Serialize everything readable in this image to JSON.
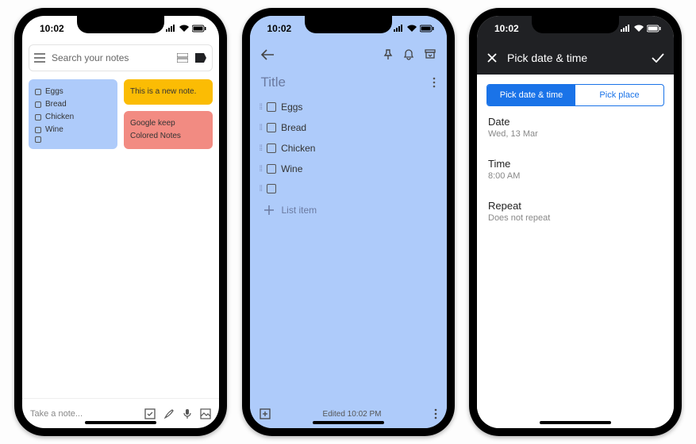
{
  "status": {
    "time": "10:02"
  },
  "phone1": {
    "search_placeholder": "Search your notes",
    "notes": {
      "checklist": [
        "Eggs",
        "Bread",
        "Chicken",
        "Wine"
      ],
      "yellow": "This is a new note.",
      "red_line1": "Google keep",
      "red_line2": "Colored Notes"
    },
    "take_note": "Take a note..."
  },
  "phone2": {
    "title_placeholder": "Title",
    "items": [
      "Eggs",
      "Bread",
      "Chicken",
      "Wine"
    ],
    "add_item": "List item",
    "edited": "Edited 10:02 PM"
  },
  "phone3": {
    "header": "Pick date & time",
    "tab_datetime": "Pick date & time",
    "tab_place": "Pick place",
    "rows": {
      "date_label": "Date",
      "date_val": "Wed, 13 Mar",
      "time_label": "Time",
      "time_val": "8:00 AM",
      "repeat_label": "Repeat",
      "repeat_val": "Does not repeat"
    }
  }
}
